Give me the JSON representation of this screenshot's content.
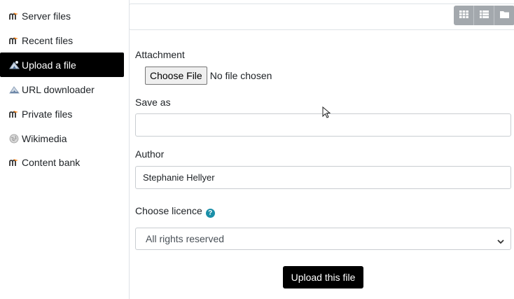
{
  "sidebar": {
    "items": [
      {
        "label": "Server files",
        "icon": "moodle-icon"
      },
      {
        "label": "Recent files",
        "icon": "moodle-icon"
      },
      {
        "label": "Upload a file",
        "icon": "upload-icon",
        "active": true
      },
      {
        "label": "URL downloader",
        "icon": "url-downloader-icon"
      },
      {
        "label": "Private files",
        "icon": "moodle-icon"
      },
      {
        "label": "Wikimedia",
        "icon": "wikimedia-icon"
      },
      {
        "label": "Content bank",
        "icon": "moodle-icon"
      }
    ]
  },
  "view_buttons": [
    "grid-view-icon",
    "list-view-icon",
    "folder-view-icon"
  ],
  "form": {
    "attachment_label": "Attachment",
    "choose_file_label": "Choose File",
    "no_file_text": "No file chosen",
    "save_as_label": "Save as",
    "save_as_value": "",
    "author_label": "Author",
    "author_value": "Stephanie Hellyer",
    "licence_label": "Choose licence",
    "licence_selected": "All rights reserved",
    "upload_button": "Upload this file"
  },
  "colors": {
    "active_bg": "#000000",
    "moodle_orange": "#f98012",
    "viewbar_bg": "#a3a8ad",
    "help_icon": "#1a8fa8"
  }
}
